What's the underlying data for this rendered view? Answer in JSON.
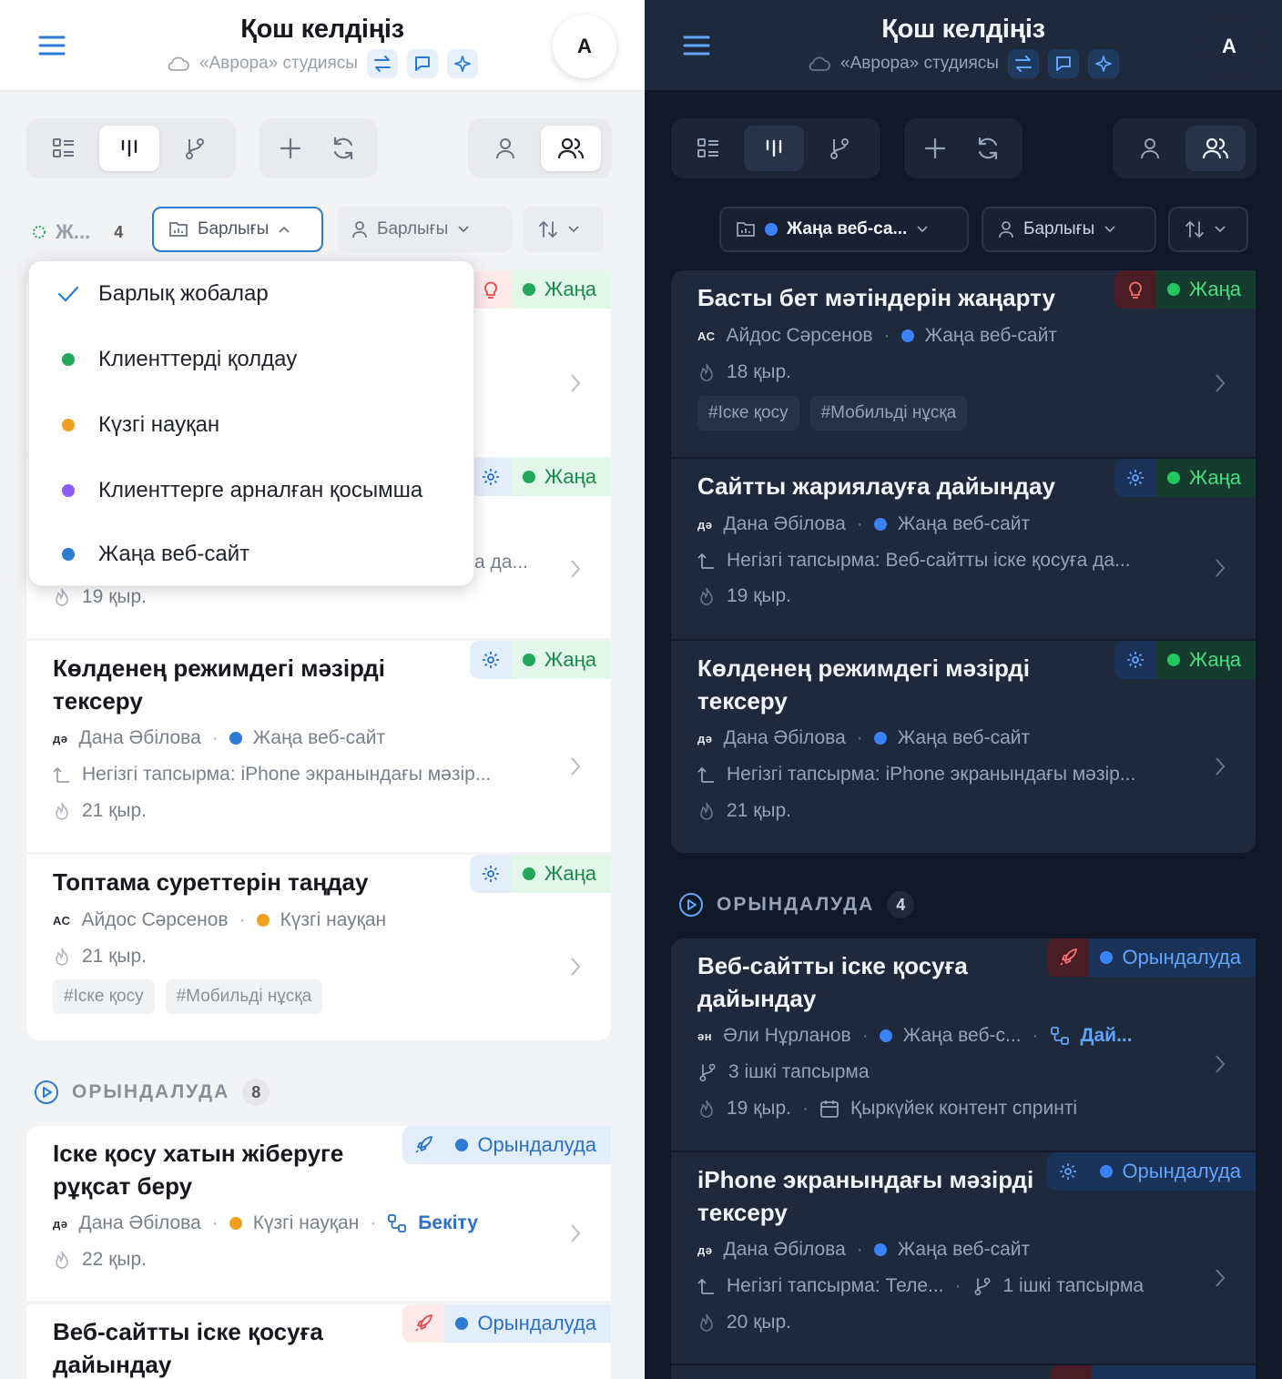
{
  "header": {
    "title": "Қош келдіңіз",
    "studio": "«Аврора» студиясы",
    "avatar_initial": "A"
  },
  "toolbar_icons": [
    "list-view-icon",
    "board-view-icon",
    "git-branch-icon",
    "plus-icon",
    "refresh-icon",
    "person-icon",
    "people-icon"
  ],
  "light": {
    "filter": {
      "group_label": "Ж...",
      "group_count": "4",
      "project_filter": "Барлығы",
      "assignee_filter": "Барлығы"
    },
    "dropdown": [
      {
        "label": "Барлық жобалар",
        "marker": "check",
        "color": "#2b7bd5"
      },
      {
        "label": "Клиенттерді қолдау",
        "marker": "dot",
        "color": "#22a85a"
      },
      {
        "label": "Күзгі науқан",
        "marker": "dot",
        "color": "#f0a020"
      },
      {
        "label": "Клиенттерге арналған қосымша",
        "marker": "dot",
        "color": "#8b5cf6"
      },
      {
        "label": "Жаңа веб-сайт",
        "marker": "dot",
        "color": "#2b7bd5"
      }
    ],
    "peek": {
      "partial_text": "а да...",
      "days": "19 қыр."
    },
    "cards": [
      {
        "title": "Көлденең режимдегі мәзірді тексеру",
        "initials": "дә",
        "assignee": "Дана Әбілова",
        "project": "Жаңа веб-сайт",
        "parent": "Негізгі тапсырма: iPhone экранындағы мәзір...",
        "days": "21 қыр.",
        "status": "Жаңа"
      },
      {
        "title": "Топтама суреттерін таңдау",
        "initials": "АС",
        "assignee": "Айдос Сәрсенов",
        "project": "Күзгі науқан",
        "days": "21 қыр.",
        "tags": [
          "#Іске қосу",
          "#Мобильді нұсқа"
        ],
        "status": "Жаңа"
      }
    ],
    "section": {
      "name": "ОРЫНДАЛУДА",
      "count": "8"
    },
    "progress_cards": [
      {
        "title": "Іске қосу хатын жіберуге рұқсат беру",
        "initials": "дә",
        "assignee": "Дана Әбілова",
        "project": "Күзгі науқан",
        "link": "Бекіту",
        "days": "22 қыр.",
        "status": "Орындалуда"
      },
      {
        "title": "Веб-сайтты іске қосуға дайындау",
        "status": "Орындалуда"
      }
    ],
    "status_new": "Жаңа"
  },
  "dark": {
    "filter": {
      "project_filter": "Жаңа веб-са...",
      "assignee_filter": "Барлығы"
    },
    "cards": [
      {
        "title": "Басты бет мәтіндерін жаңарту",
        "initials": "АС",
        "assignee": "Айдос Сәрсенов",
        "project": "Жаңа веб-сайт",
        "days": "18 қыр.",
        "tags": [
          "#Іске қосу",
          "#Мобильді нұсқа"
        ],
        "status": "Жаңа"
      },
      {
        "title": "Сайтты жариялауға дайындау",
        "initials": "дә",
        "assignee": "Дана Әбілова",
        "project": "Жаңа веб-сайт",
        "parent": "Негізгі тапсырма: Веб-сайтты іске қосуға да...",
        "days": "19 қыр.",
        "status": "Жаңа"
      },
      {
        "title": "Көлденең режимдегі мәзірді тексеру",
        "initials": "дә",
        "assignee": "Дана Әбілова",
        "project": "Жаңа веб-сайт",
        "parent": "Негізгі тапсырма: iPhone экранындағы мәзір...",
        "days": "21 қыр.",
        "status": "Жаңа"
      }
    ],
    "section": {
      "name": "ОРЫНДАЛУДА",
      "count": "4"
    },
    "progress_cards": [
      {
        "title": "Веб-сайтты іске қосуға дайындау",
        "initials": "ән",
        "assignee": "Әли Нұрланов",
        "project": "Жаңа веб-с...",
        "link": "Дай...",
        "subtasks": "3 ішкі тапсырма",
        "days": "19 қыр.",
        "sprint": "Қыркүйек контент спринті",
        "status": "Орындалуда"
      },
      {
        "title": "iPhone экранындағы мәзірді тексеру",
        "initials": "дә",
        "assignee": "Дана Әбілова",
        "project": "Жаңа веб-сайт",
        "parent": "Негізгі тапсырма: Теле...",
        "subtasks": "1 ішкі тапсырма",
        "days": "20 қыр.",
        "status": "Орындалуда"
      }
    ]
  },
  "colors": {
    "accent": "#2b7bd5",
    "green": "#22a85a",
    "orange": "#f0a020",
    "purple": "#8b5cf6",
    "red": "#e5484d"
  }
}
